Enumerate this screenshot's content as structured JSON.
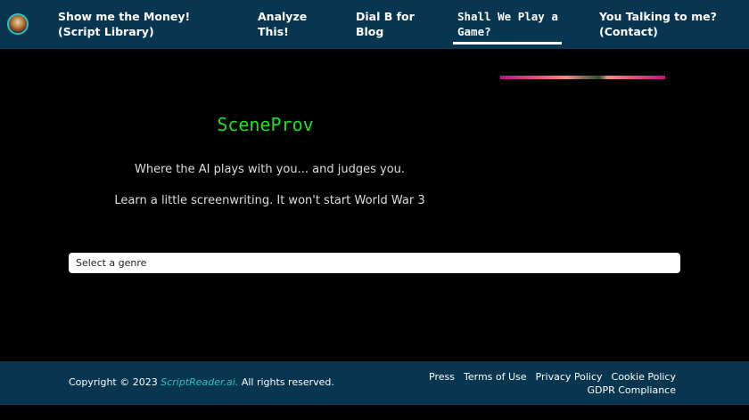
{
  "nav": {
    "items": [
      {
        "label": "Show me the Money! (Script Library)"
      },
      {
        "label": "Analyze This!"
      },
      {
        "label": "Dial B for Blog"
      },
      {
        "label": "Shall We Play a Game?",
        "active": true
      },
      {
        "label": "You Talking to me? (Contact)"
      }
    ]
  },
  "main": {
    "title": "SceneProv",
    "tagline": "Where the AI plays with you... and judges you.",
    "subtitle": "Learn a little screenwriting. It won't start World War 3",
    "genre_select": "Select a genre"
  },
  "footer": {
    "copyright_prefix": "Copyright © 2023 ",
    "brand": "ScriptReader.ai.",
    "copyright_suffix": " All rights reserved.",
    "links": [
      "Press",
      "Terms of Use",
      "Privacy Policy",
      "Cookie Policy",
      "GDPR Compliance"
    ]
  },
  "colors": {
    "nav_bg": "#083550",
    "accent": "#2ac0c0",
    "title": "#1fe01f"
  }
}
